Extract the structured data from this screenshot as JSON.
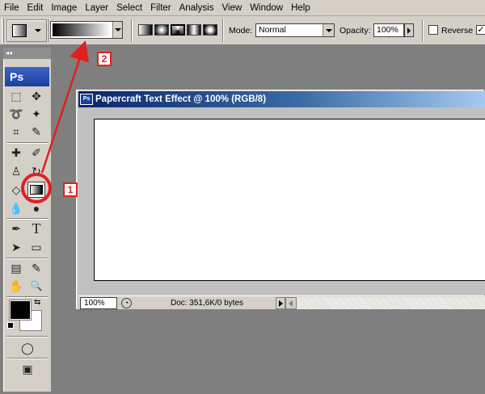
{
  "menu": [
    "File",
    "Edit",
    "Image",
    "Layer",
    "Select",
    "Filter",
    "Analysis",
    "View",
    "Window",
    "Help"
  ],
  "options": {
    "mode_label": "Mode:",
    "mode_value": "Normal",
    "opacity_label": "Opacity:",
    "opacity_value": "100%",
    "reverse_label": "Reverse",
    "reverse_checked": false
  },
  "toolbox": {
    "title_icon": "collapse-arrows-icon",
    "logo": "Ps",
    "tools": [
      {
        "name": "rectangular-marquee-icon",
        "glyph": "⬚"
      },
      {
        "name": "move-tool-icon",
        "glyph": "✥"
      },
      {
        "name": "lasso-icon",
        "glyph": "➰"
      },
      {
        "name": "magic-wand-icon",
        "glyph": "✦"
      },
      {
        "name": "crop-icon",
        "glyph": "⌗"
      },
      {
        "name": "slice-icon",
        "glyph": "✎"
      },
      {
        "name": "healing-brush-icon",
        "glyph": "✚"
      },
      {
        "name": "brush-icon",
        "glyph": "✐"
      },
      {
        "name": "clone-stamp-icon",
        "glyph": "♙"
      },
      {
        "name": "history-brush-icon",
        "glyph": "↻"
      },
      {
        "name": "eraser-icon",
        "glyph": "◇"
      },
      {
        "name": "gradient-tool-icon",
        "glyph": ""
      },
      {
        "name": "blur-icon",
        "glyph": "💧"
      },
      {
        "name": "dodge-icon",
        "glyph": "●"
      },
      {
        "name": "pen-icon",
        "glyph": "✒"
      },
      {
        "name": "type-tool-icon",
        "glyph": "T"
      },
      {
        "name": "path-selection-icon",
        "glyph": "➤"
      },
      {
        "name": "rectangle-shape-icon",
        "glyph": "▭"
      },
      {
        "name": "notes-icon",
        "glyph": "▤"
      },
      {
        "name": "eyedropper-icon",
        "glyph": "✎"
      },
      {
        "name": "hand-tool-icon",
        "glyph": "✋"
      },
      {
        "name": "zoom-tool-icon",
        "glyph": "🔍"
      }
    ],
    "bottom": {
      "quick-mask-icon": "◯",
      "screen-mode-icon": "▣"
    }
  },
  "document": {
    "title": "Papercraft Text Effect @ 100% (RGB/8)",
    "ps_icon": "Ps",
    "zoom": "100%",
    "status": "Doc: 351,6K/0 bytes"
  },
  "annotations": {
    "step1": "1",
    "step2": "2",
    "color": "#e02020"
  }
}
